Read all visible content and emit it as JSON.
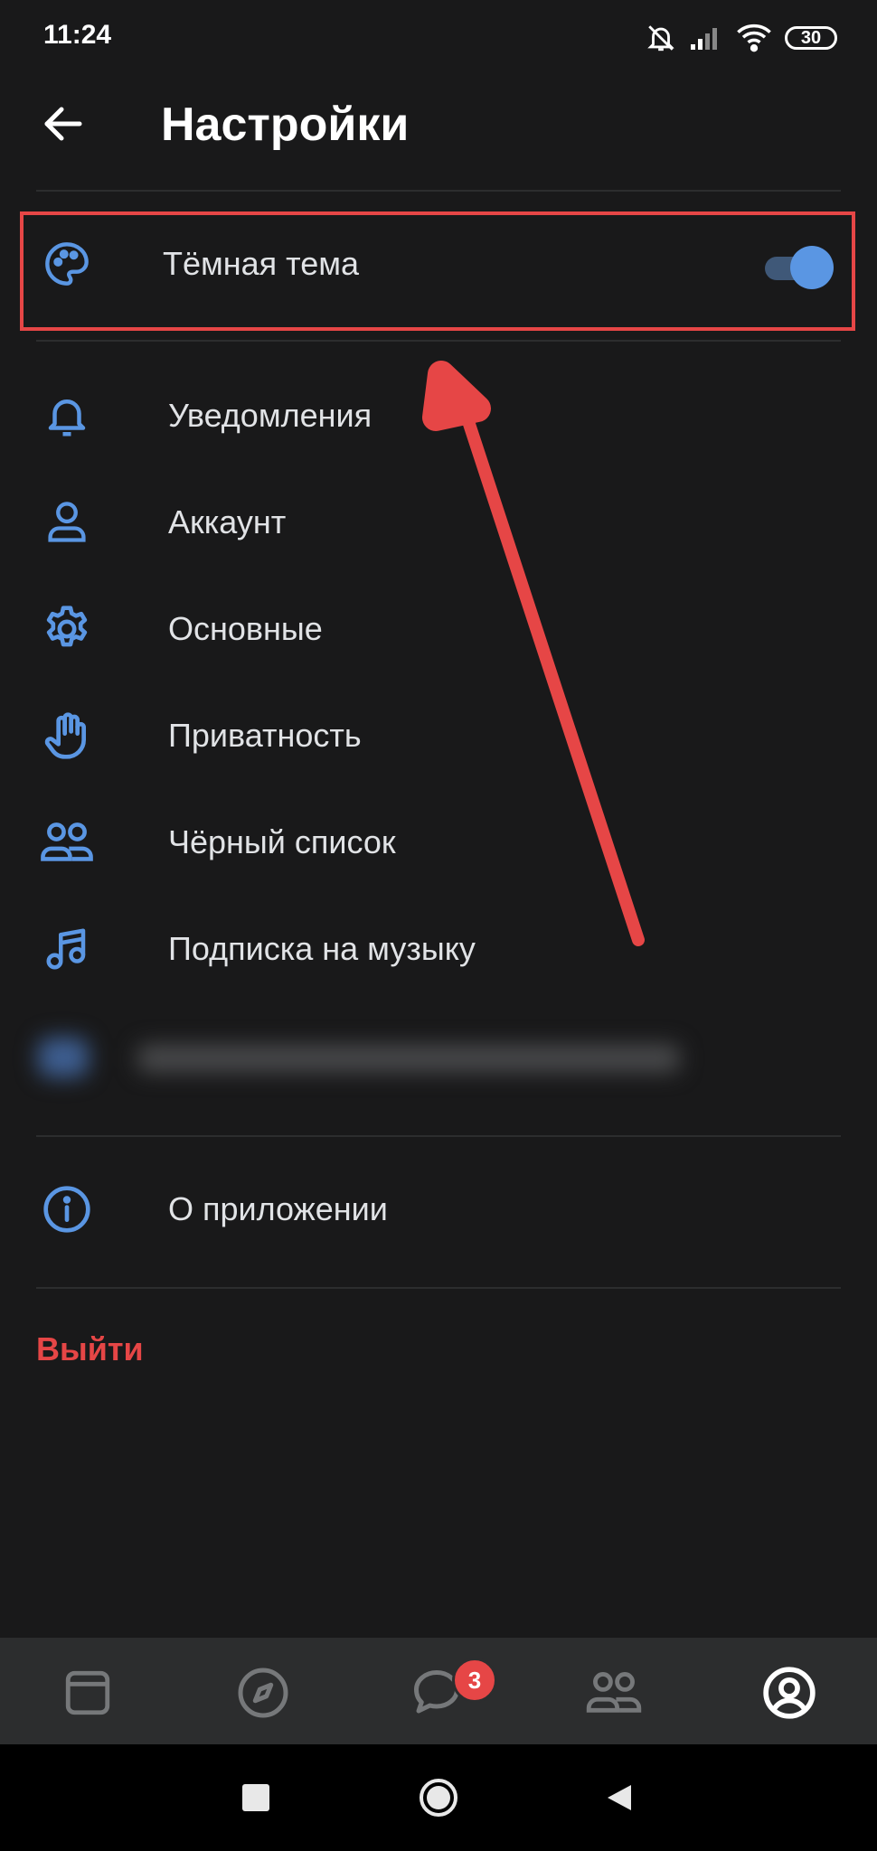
{
  "status_bar": {
    "time": "11:24",
    "battery": "30"
  },
  "header": {
    "title": "Настройки"
  },
  "dark_theme": {
    "label": "Тёмная тема",
    "enabled": true
  },
  "menu": {
    "items": [
      {
        "label": "Уведомления",
        "icon": "bell-icon"
      },
      {
        "label": "Аккаунт",
        "icon": "user-icon"
      },
      {
        "label": "Основные",
        "icon": "gear-icon"
      },
      {
        "label": "Приватность",
        "icon": "hand-icon"
      },
      {
        "label": "Чёрный список",
        "icon": "users-icon"
      },
      {
        "label": "Подписка на музыку",
        "icon": "music-icon"
      }
    ]
  },
  "about": {
    "label": "О приложении",
    "icon": "info-icon"
  },
  "logout": {
    "label": "Выйти"
  },
  "tabbar": {
    "messages_badge": "3"
  },
  "colors": {
    "accent": "#5a96e3",
    "danger": "#e64646",
    "background": "#19191a"
  }
}
